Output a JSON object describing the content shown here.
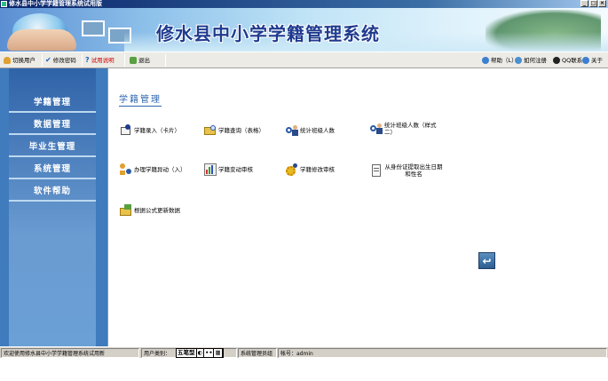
{
  "window": {
    "title": "修水县中小学学籍管理系统试用版"
  },
  "banner": {
    "title": "修水县中小学学籍管理系统"
  },
  "toolbar": {
    "left": [
      {
        "label": "切换用户",
        "icon": "switch-user-icon"
      },
      {
        "label": "修改密码",
        "icon": "checkmark-icon"
      },
      {
        "label": "试用说明",
        "icon": "help-question-icon"
      },
      {
        "label": "退出",
        "icon": "exit-icon"
      }
    ],
    "right": [
      {
        "label": "帮助（L）",
        "icon": "help-icon"
      },
      {
        "label": "如何注册",
        "icon": "register-icon"
      },
      {
        "label": "QQ联系",
        "icon": "qq-icon"
      },
      {
        "label": "关于",
        "icon": "about-icon"
      }
    ]
  },
  "sidebar": {
    "items": [
      {
        "label": "学籍管理"
      },
      {
        "label": "数据管理"
      },
      {
        "label": "毕业生管理"
      },
      {
        "label": "系统管理"
      },
      {
        "label": "软件帮助"
      }
    ]
  },
  "main": {
    "title": "学籍管理",
    "items": [
      {
        "label": "学籍录入（卡片）",
        "icon": "card-entry-icon"
      },
      {
        "label": "学籍查询（表格）",
        "icon": "folder-search-icon"
      },
      {
        "label": "统计班级人数",
        "icon": "magnifier-person-icon"
      },
      {
        "label": "统计班级人数（样式二）",
        "icon": "magnifier-person-icon"
      },
      {
        "label": "办理学籍异动（入）",
        "icon": "transfer-people-icon"
      },
      {
        "label": "学籍变动审核",
        "icon": "chart-icon"
      },
      {
        "label": "学籍修改审核",
        "icon": "gear-person-icon"
      },
      {
        "label": "从身份证提取出生日期和性名",
        "icon": "document-icon"
      },
      {
        "label": "根据公式更新数据",
        "icon": "folder-formula-icon"
      }
    ],
    "back_icon": "back-arrow-icon"
  },
  "statusbar": {
    "welcome": "欢迎使用修水县中小学学籍管理系统试用新",
    "user_type_label": "用户类别：",
    "ime": [
      "五笔型",
      "◐",
      "••",
      "▦"
    ],
    "user_type": "系统管理员组",
    "account": "帐号：admin"
  }
}
